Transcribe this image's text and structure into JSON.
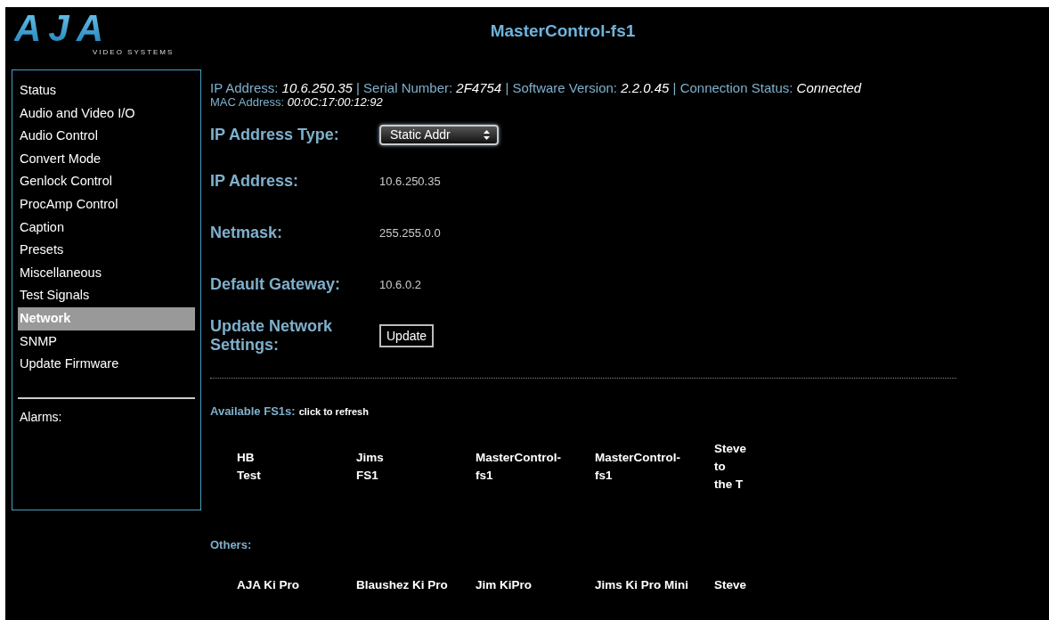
{
  "logo": {
    "mark": "AJA",
    "tagline": "VIDEO SYSTEMS"
  },
  "title": "MasterControl-fs1",
  "sidebar": {
    "items": [
      {
        "label": "Status",
        "selected": false
      },
      {
        "label": "Audio and Video I/O",
        "selected": false
      },
      {
        "label": "Audio Control",
        "selected": false
      },
      {
        "label": "Convert Mode",
        "selected": false
      },
      {
        "label": "Genlock Control",
        "selected": false
      },
      {
        "label": "ProcAmp Control",
        "selected": false
      },
      {
        "label": "Caption",
        "selected": false
      },
      {
        "label": "Presets",
        "selected": false
      },
      {
        "label": "Miscellaneous",
        "selected": false
      },
      {
        "label": "Test Signals",
        "selected": false
      },
      {
        "label": "Network",
        "selected": true
      },
      {
        "label": "SNMP",
        "selected": false
      },
      {
        "label": "Update Firmware",
        "selected": false
      }
    ],
    "alarms_label": "Alarms:"
  },
  "info_separator": "|",
  "info": [
    {
      "label": "IP Address:",
      "value": "10.6.250.35"
    },
    {
      "label": "Serial Number:",
      "value": "2F4754"
    },
    {
      "label": "Software Version:",
      "value": "2.2.0.45"
    },
    {
      "label": "Connection Status:",
      "value": "Connected"
    }
  ],
  "mac": {
    "label": "MAC Address:",
    "value": "00:0C:17:00:12:92"
  },
  "form": [
    {
      "kind": "select",
      "label": "IP Address Type:",
      "value": "Static Addr"
    },
    {
      "kind": "text",
      "label": "IP Address:",
      "value": "10.6.250.35"
    },
    {
      "kind": "text",
      "label": "Netmask:",
      "value": "255.255.0.0"
    },
    {
      "kind": "text",
      "label": "Default Gateway:",
      "value": "10.6.0.2"
    },
    {
      "kind": "button",
      "label": "Update Network Settings:",
      "value": "Update"
    }
  ],
  "available": {
    "label": "Available FS1s:",
    "hint": "click to refresh",
    "devices": [
      "HB Test",
      "Jims FS1",
      "MasterControl-fs1",
      "MasterControl-fs1",
      "Steve to the T"
    ]
  },
  "others": {
    "label": "Others:",
    "devices": [
      "AJA Ki Pro",
      "Blaushez Ki Pro",
      "Jim KiPro",
      "Jims Ki Pro Mini",
      "Steve"
    ]
  }
}
